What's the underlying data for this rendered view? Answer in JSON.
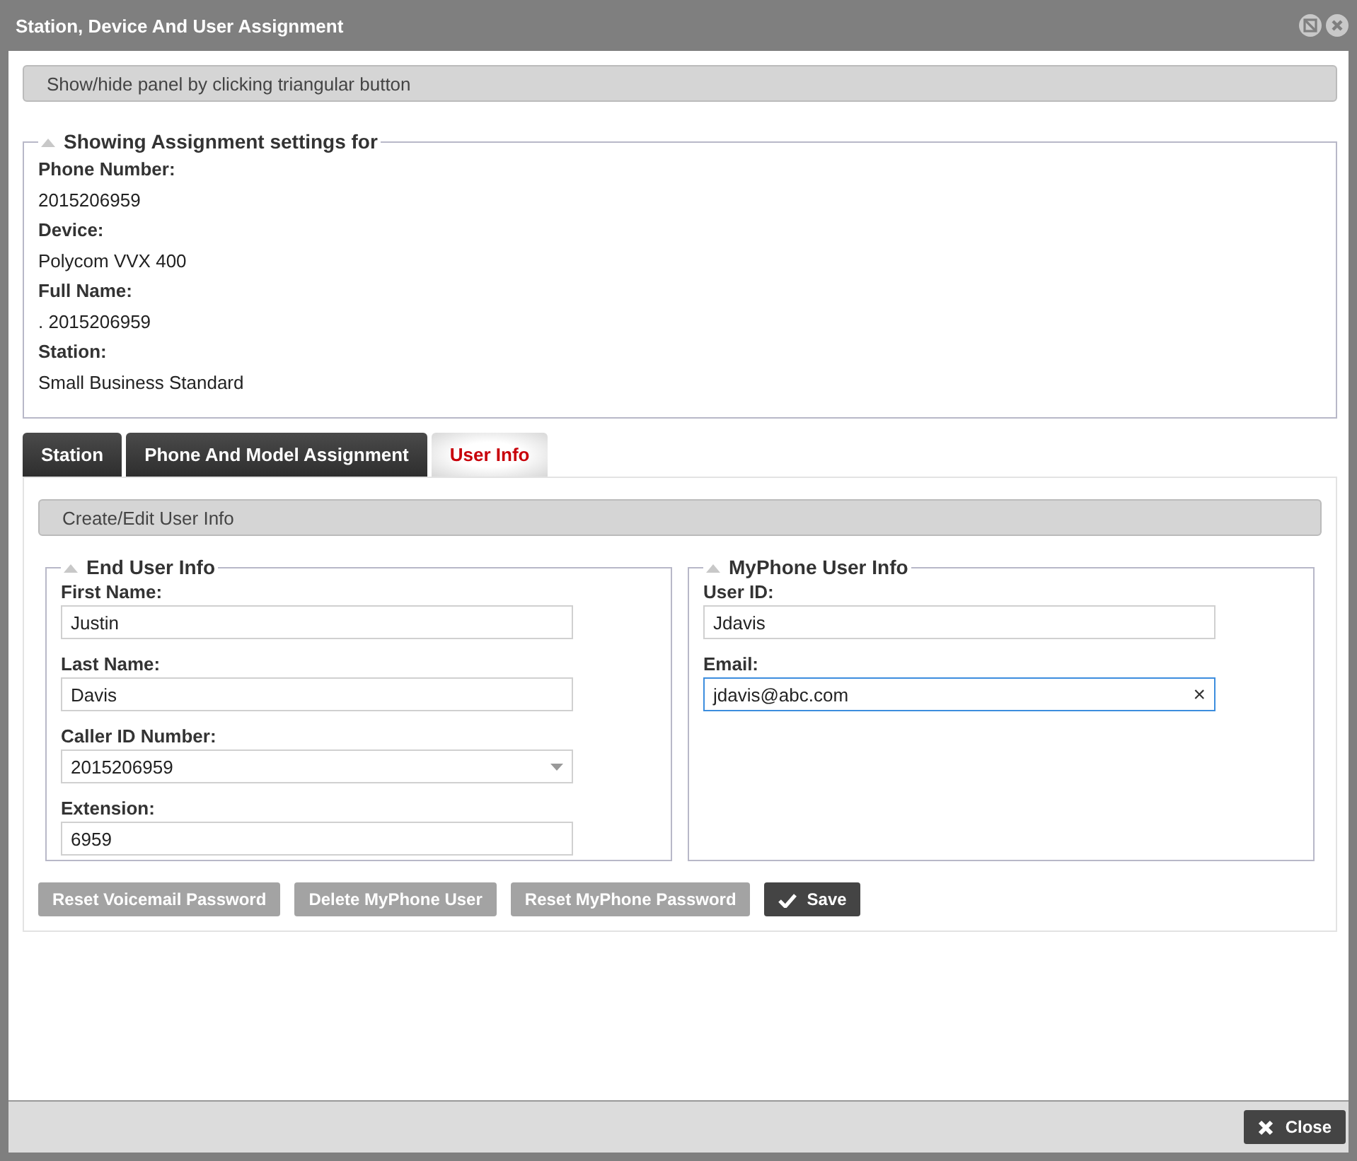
{
  "window": {
    "title": "Station, Device And User Assignment"
  },
  "hint_bar": {
    "text": "Show/hide panel by clicking triangular button"
  },
  "summary": {
    "legend": "Showing Assignment settings for",
    "expanded": true,
    "items": [
      {
        "label": "Phone Number:",
        "value": "2015206959"
      },
      {
        "label": "Device:",
        "value": "Polycom VVX 400"
      },
      {
        "label": "Full Name:",
        "value": ". 2015206959"
      },
      {
        "label": "Station:",
        "value": "Small Business Standard"
      }
    ]
  },
  "tabs": [
    {
      "label": "Station",
      "selected": false
    },
    {
      "label": "Phone And Model Assignment",
      "selected": false
    },
    {
      "label": "User Info",
      "selected": true
    }
  ],
  "section_bar": {
    "text": "Create/Edit User Info"
  },
  "groups": [
    {
      "legend": "End User Info",
      "expanded": true,
      "fields": [
        {
          "kind": "text",
          "label": "First Name:",
          "value": "Justin",
          "focused": false
        },
        {
          "kind": "text",
          "label": "Last Name:",
          "value": "Davis",
          "focused": false
        },
        {
          "kind": "select",
          "label": "Caller ID Number:",
          "value": "2015206959",
          "focused": false
        },
        {
          "kind": "text",
          "label": "Extension:",
          "value": "6959",
          "focused": false
        }
      ]
    },
    {
      "legend": "MyPhone User Info",
      "expanded": true,
      "fields": [
        {
          "kind": "text",
          "label": "User ID:",
          "value": "Jdavis",
          "focused": false
        },
        {
          "kind": "clearable",
          "label": "Email:",
          "value": "jdavis@abc.com",
          "focused": true,
          "clear": "×"
        }
      ]
    }
  ],
  "actions": [
    {
      "kind": "secondary",
      "label": "Reset Voicemail Password"
    },
    {
      "kind": "secondary",
      "label": "Delete MyPhone User"
    },
    {
      "kind": "secondary",
      "label": "Reset MyPhone Password"
    },
    {
      "kind": "primary",
      "label": "Save"
    }
  ],
  "footer": {
    "close_button": "Close"
  }
}
